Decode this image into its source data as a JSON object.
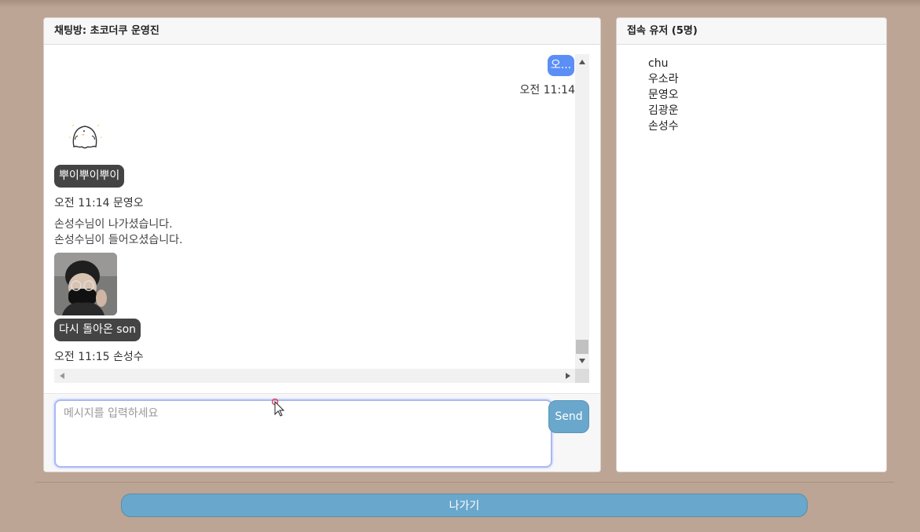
{
  "chat": {
    "header": "채팅방: 초코더쿠 운영진",
    "messages": {
      "mine_text": "오...",
      "mine_time": "오전 11:14",
      "other1_text": "뿌이뿌이뿌이",
      "other1_meta": "오전 11:14 문영오",
      "system1": "손성수님이 나가셨습니다.",
      "system2": "손성수님이 들어오셨습니다.",
      "other2_text": "다시 돌아온 son",
      "other2_meta": "오전 11:15 손성수"
    },
    "input": {
      "placeholder": "메시지를 입력하세요",
      "value": "",
      "send_label": "Send"
    }
  },
  "users": {
    "header": "접속 유저 (5명)",
    "list": [
      "chu",
      "우소라",
      "문영오",
      "김광운",
      "손성수"
    ]
  },
  "footer": {
    "leave_label": "나가기"
  },
  "colors": {
    "background": "#bca595",
    "my_bubble": "#5b8ff5",
    "other_bubble": "#444444",
    "button": "#6aa7cc"
  }
}
